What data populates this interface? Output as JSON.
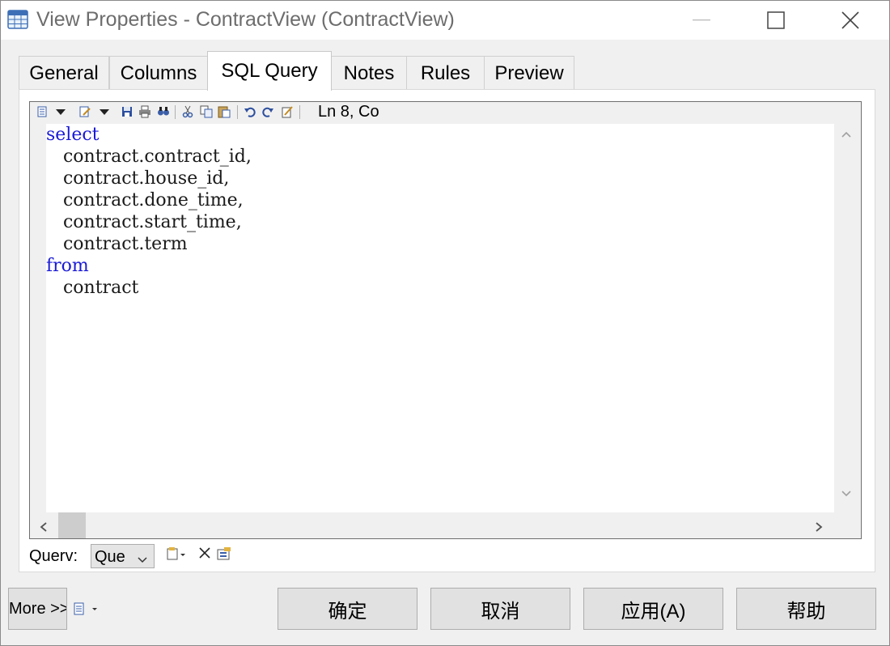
{
  "window": {
    "title": "View Properties - ContractView (ContractView)",
    "icon": "table-grid-icon",
    "controls": [
      "minimize-icon",
      "maximize-icon",
      "close-icon"
    ]
  },
  "tabs": [
    {
      "label": "General",
      "active": false
    },
    {
      "label": "Columns",
      "active": false
    },
    {
      "label": "SQL Query",
      "active": true
    },
    {
      "label": "Notes",
      "active": false
    },
    {
      "label": "Rules",
      "active": false
    },
    {
      "label": "Preview",
      "active": false
    }
  ],
  "editor": {
    "status": "Ln 8, Co",
    "toolbar_icons": [
      "properties-icon",
      "dropdown-arrow-icon",
      "edit-icon",
      "dropdown-arrow-icon",
      "save-icon",
      "print-icon",
      "find-icon",
      "cut-icon",
      "copy-icon",
      "paste-icon",
      "undo-icon",
      "redo-icon",
      "edit-with-icon"
    ],
    "lines": [
      {
        "indent": "",
        "text": "select",
        "keyword": true
      },
      {
        "indent": "   ",
        "text": "contract.contract_id,",
        "keyword": false
      },
      {
        "indent": "   ",
        "text": "contract.house_id,",
        "keyword": false
      },
      {
        "indent": "   ",
        "text": "contract.done_time,",
        "keyword": false
      },
      {
        "indent": "   ",
        "text": "contract.start_time,",
        "keyword": false
      },
      {
        "indent": "   ",
        "text": "contract.term",
        "keyword": false
      },
      {
        "indent": "",
        "text": "from",
        "keyword": true
      },
      {
        "indent": "   ",
        "text": "contract",
        "keyword": false
      }
    ],
    "colors": {
      "keyword": "#1a1ad6",
      "text": "#1a1a1a"
    }
  },
  "query": {
    "label": "Querv:",
    "selected": "Que",
    "icons": [
      "new-query-icon",
      "delete-icon",
      "query-properties-icon"
    ]
  },
  "footer": {
    "more_label": "More >>",
    "more_menu_icon": "properties-menu-icon",
    "ok": "确定",
    "cancel": "取消",
    "apply": "应用(A)",
    "help": "帮助"
  }
}
